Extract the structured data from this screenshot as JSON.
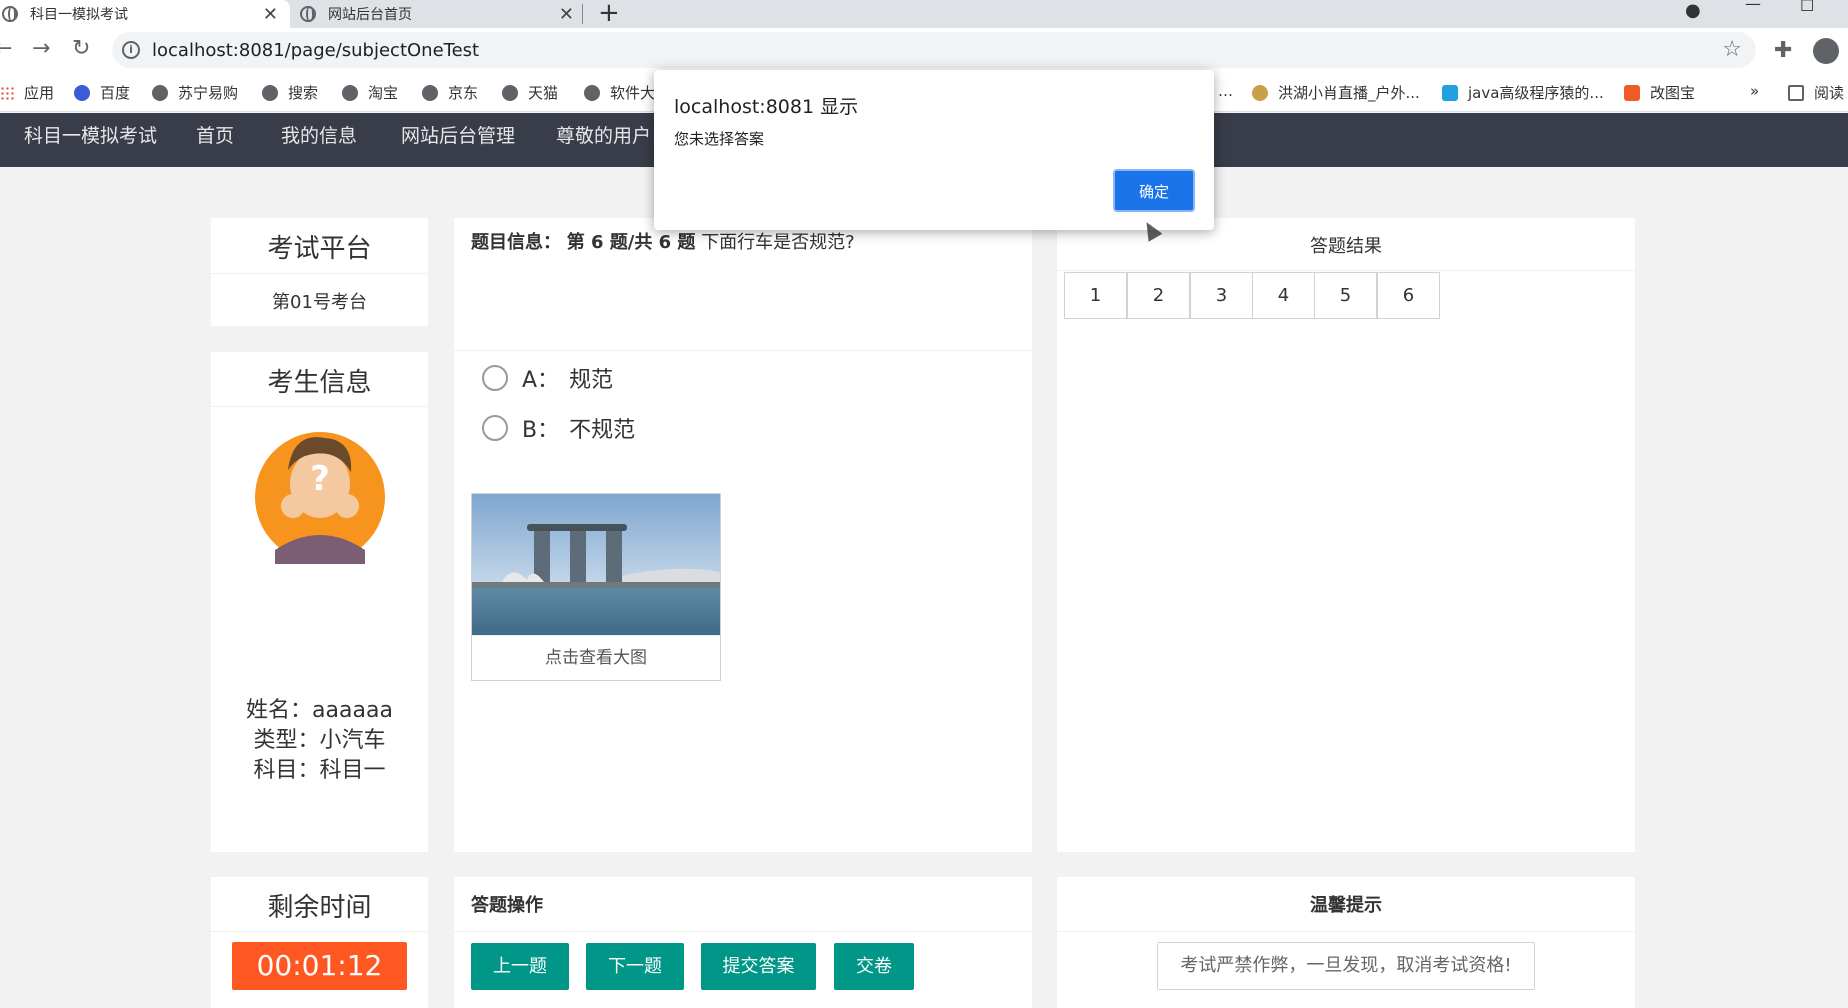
{
  "browser": {
    "tabs": [
      {
        "label": "科目一模拟考试",
        "active": true
      },
      {
        "label": "网站后台首页",
        "active": false
      }
    ],
    "new_tab": "+",
    "url": "localhost:8081/page/subjectOneTest",
    "bookmarks": [
      "应用",
      "百度",
      "苏宁易购",
      "搜索",
      "淘宝",
      "京东",
      "天猫",
      "软件大",
      "…",
      "洪湖小肖直播_户外...",
      "java高级程序猿的...",
      "改图宝",
      "»",
      "阅读"
    ]
  },
  "sitenav": {
    "items": [
      "科目一模拟考试",
      "首页",
      "我的信息",
      "网站后台管理",
      "尊敬的用户 a"
    ]
  },
  "platform": {
    "title": "考试平台",
    "station": "第01号考台"
  },
  "examinee": {
    "title": "考生信息",
    "name": "姓名：aaaaaa",
    "type": "类型：小汽车",
    "subject": "科目一"
  },
  "examinee_subject_prefix": "科目：",
  "question": {
    "label": "题目信息：",
    "progress": "第 6 题/共 6 题",
    "text": "下面行车是否规范?",
    "options": [
      {
        "key": "A：",
        "text": "规范"
      },
      {
        "key": "B：",
        "text": "不规范"
      }
    ],
    "image_caption": "点击查看大图"
  },
  "results": {
    "title": "答题结果",
    "numbers": [
      "1",
      "2",
      "3",
      "4",
      "5",
      "6"
    ]
  },
  "timer": {
    "title": "剩余时间",
    "value": "00:01:12"
  },
  "operations": {
    "title": "答题操作",
    "buttons": [
      "上一题",
      "下一题",
      "提交答案",
      "交卷"
    ]
  },
  "tips": {
    "title": "温馨提示",
    "text": "考试严禁作弊，一旦发现，取消考试资格!"
  },
  "dialog": {
    "title": "localhost:8081 显示",
    "message": "您未选择答案",
    "ok": "确定"
  },
  "colors": {
    "nav_bg": "#393d49",
    "green": "#009688",
    "timer": "#ff5722",
    "dialog_button": "#1a73e8"
  }
}
